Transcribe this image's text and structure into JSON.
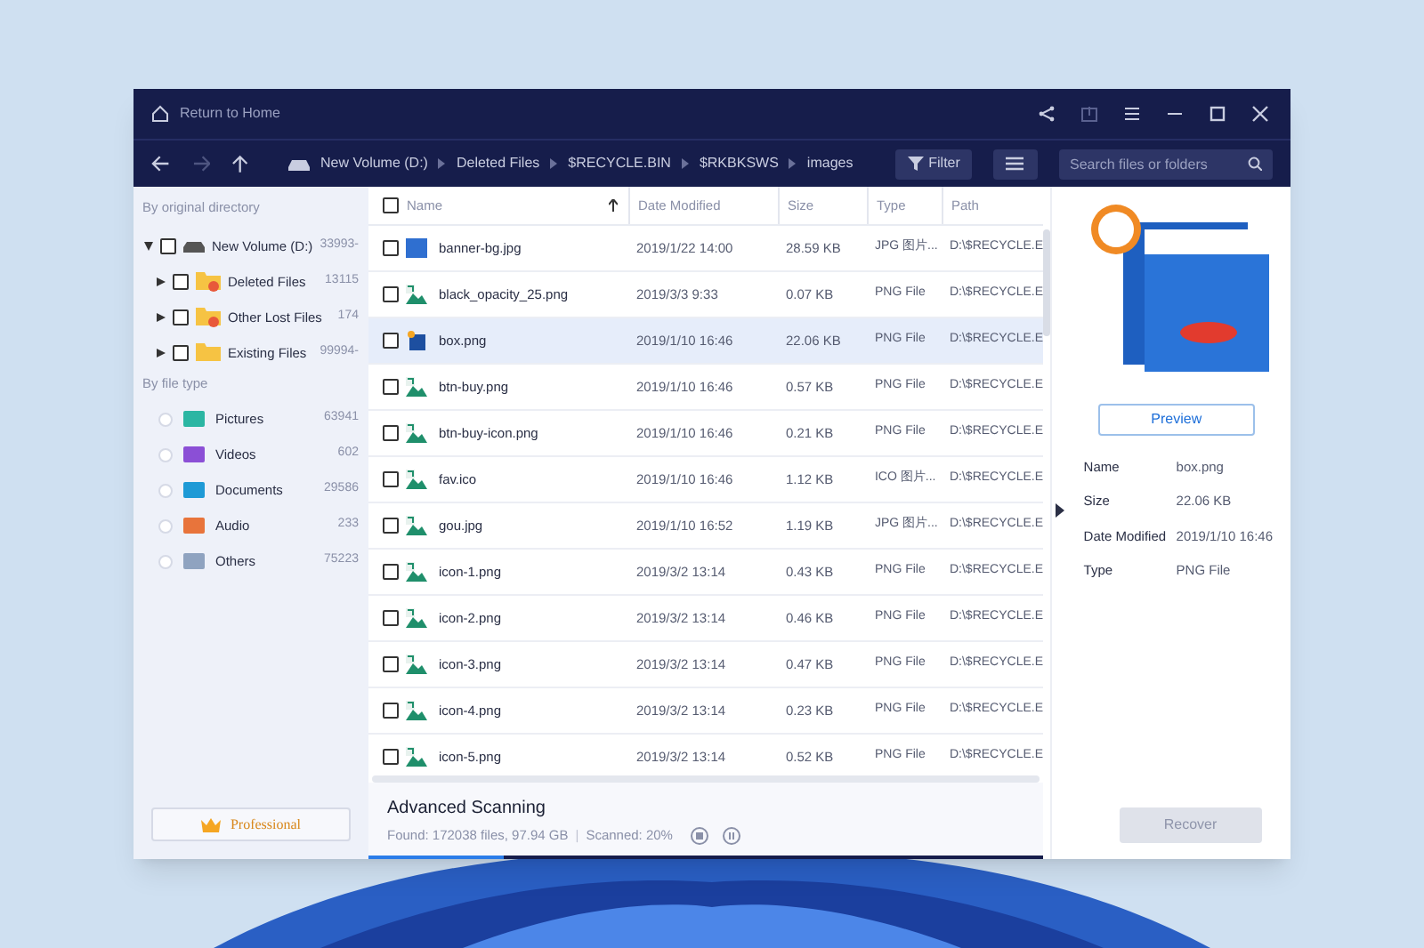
{
  "titlebar": {
    "home_label": "Return to Home"
  },
  "breadcrumb": [
    "New Volume (D:)",
    "Deleted Files",
    "$RECYCLE.BIN",
    "$RKBKSWS",
    "images"
  ],
  "toolbar": {
    "filter_label": "Filter",
    "search": {
      "placeholder": "Search files or folders"
    }
  },
  "sidebar": {
    "directory_heading": "By original directory",
    "tree": [
      {
        "label": "New Volume (D:)",
        "count": "33993-",
        "kind": "drive",
        "expanded": true,
        "checked": false,
        "children": [
          {
            "label": "Deleted Files",
            "count": "13115",
            "kind": "deleted",
            "expanded": false,
            "checked": false
          },
          {
            "label": "Other Lost Files",
            "count": "174",
            "kind": "lost",
            "expanded": false,
            "checked": false
          },
          {
            "label": "Existing Files",
            "count": "99994-",
            "kind": "existing",
            "expanded": false,
            "checked": false
          }
        ]
      }
    ],
    "type_heading": "By file type",
    "types": [
      {
        "label": "Pictures",
        "count": "63941",
        "color": "#2bb6a3",
        "checked": false
      },
      {
        "label": "Videos",
        "count": "602",
        "color": "#8b4fd6",
        "checked": false
      },
      {
        "label": "Documents",
        "count": "29586",
        "color": "#1e9ad6",
        "checked": false
      },
      {
        "label": "Audio",
        "count": "233",
        "color": "#e8743b",
        "checked": false
      },
      {
        "label": "Others",
        "count": "75223",
        "color": "#8fa3c0",
        "checked": false
      }
    ],
    "professional_label": "Professional"
  },
  "table": {
    "columns": [
      "Name",
      "Date Modified",
      "Size",
      "Type",
      "Path"
    ],
    "all_checked": false,
    "rows": [
      {
        "name": "banner-bg.jpg",
        "date": "2019/1/22 14:00",
        "size": "28.59 KB",
        "type": "JPG 图片...",
        "path": "D:\\$RECYCLE.E",
        "kind": "photo",
        "selected": false,
        "checked": false
      },
      {
        "name": "black_opacity_25.png",
        "date": "2019/3/3 9:33",
        "size": "0.07 KB",
        "type": "PNG File",
        "path": "D:\\$RECYCLE.E",
        "kind": "image",
        "selected": false,
        "checked": false
      },
      {
        "name": "box.png",
        "date": "2019/1/10 16:46",
        "size": "22.06 KB",
        "type": "PNG File",
        "path": "D:\\$RECYCLE.E",
        "kind": "box",
        "selected": true,
        "checked": false
      },
      {
        "name": "btn-buy.png",
        "date": "2019/1/10 16:46",
        "size": "0.57 KB",
        "type": "PNG File",
        "path": "D:\\$RECYCLE.E",
        "kind": "image",
        "selected": false,
        "checked": false
      },
      {
        "name": "btn-buy-icon.png",
        "date": "2019/1/10 16:46",
        "size": "0.21 KB",
        "type": "PNG File",
        "path": "D:\\$RECYCLE.E",
        "kind": "image",
        "selected": false,
        "checked": false
      },
      {
        "name": "fav.ico",
        "date": "2019/1/10 16:46",
        "size": "1.12 KB",
        "type": "ICO 图片...",
        "path": "D:\\$RECYCLE.E",
        "kind": "image",
        "selected": false,
        "checked": false
      },
      {
        "name": "gou.jpg",
        "date": "2019/1/10 16:52",
        "size": "1.19 KB",
        "type": "JPG 图片...",
        "path": "D:\\$RECYCLE.E",
        "kind": "image",
        "selected": false,
        "checked": false
      },
      {
        "name": "icon-1.png",
        "date": "2019/3/2 13:14",
        "size": "0.43 KB",
        "type": "PNG File",
        "path": "D:\\$RECYCLE.E",
        "kind": "image",
        "selected": false,
        "checked": false
      },
      {
        "name": "icon-2.png",
        "date": "2019/3/2 13:14",
        "size": "0.46 KB",
        "type": "PNG File",
        "path": "D:\\$RECYCLE.E",
        "kind": "image",
        "selected": false,
        "checked": false
      },
      {
        "name": "icon-3.png",
        "date": "2019/3/2 13:14",
        "size": "0.47 KB",
        "type": "PNG File",
        "path": "D:\\$RECYCLE.E",
        "kind": "image",
        "selected": false,
        "checked": false
      },
      {
        "name": "icon-4.png",
        "date": "2019/3/2 13:14",
        "size": "0.23 KB",
        "type": "PNG File",
        "path": "D:\\$RECYCLE.E",
        "kind": "image",
        "selected": false,
        "checked": false
      },
      {
        "name": "icon-5.png",
        "date": "2019/3/2 13:14",
        "size": "0.52 KB",
        "type": "PNG File",
        "path": "D:\\$RECYCLE.E",
        "kind": "image",
        "selected": false,
        "checked": false
      }
    ]
  },
  "scan": {
    "title": "Advanced Scanning",
    "found": "Found: 172038 files, 97.94 GB",
    "separator": "|",
    "scanned": "Scanned: 20%",
    "level": 0.2
  },
  "preview": {
    "button": "Preview",
    "details": [
      {
        "label": "Name",
        "value": "box.png"
      },
      {
        "label": "Size",
        "value": "22.06 KB"
      },
      {
        "label": "Date Modified",
        "value": "2019/1/10 16:46"
      },
      {
        "label": "Type",
        "value": "PNG File"
      }
    ],
    "recover_label": "Recover",
    "recover_disabled": true
  }
}
